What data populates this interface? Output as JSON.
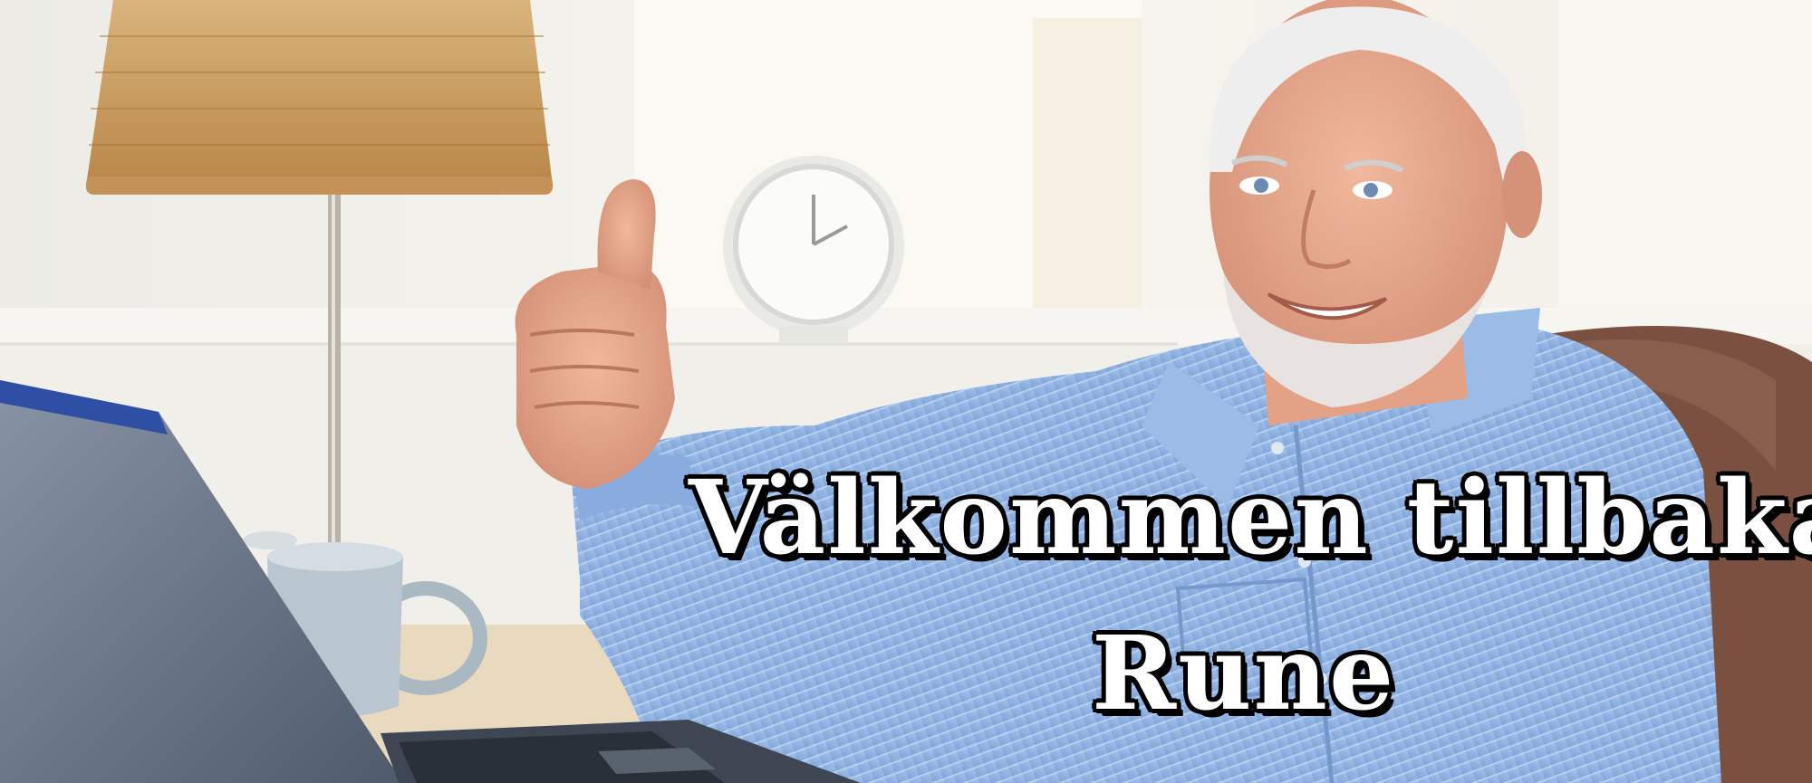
{
  "caption": {
    "line1": "Välkommen tillbaka",
    "line2": "Rune"
  },
  "colors": {
    "background_window": "#f3f1ea",
    "shirt": "#8fb3e3",
    "shirt_shadow": "#6f95cc",
    "skin": "#e5a88e",
    "hair": "#eeeeee",
    "lamp_shade": "#c99a5c",
    "laptop": "#6d7a90",
    "mug": "#b9c6cf",
    "chair": "#7a5140",
    "desk": "#e8d9bf",
    "caption_fill": "#ffffff",
    "caption_outline": "#000000"
  }
}
